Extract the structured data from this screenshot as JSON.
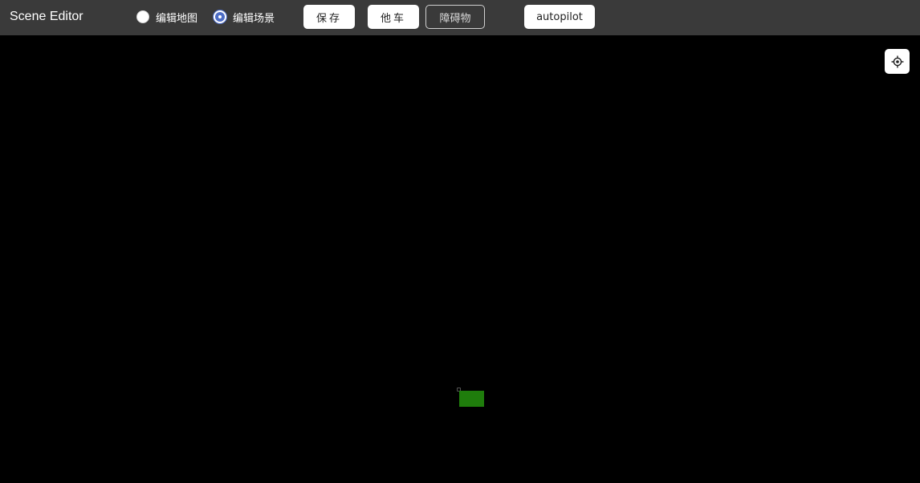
{
  "app": {
    "title": "Scene Editor"
  },
  "mode": {
    "options": [
      {
        "label": "编辑地图",
        "checked": false
      },
      {
        "label": "编辑场景",
        "checked": true
      }
    ]
  },
  "toolbar": {
    "save_label": "保存",
    "other_car_label": "他车",
    "obstacle_label": "障碍物",
    "autopilot_label": "autopilot"
  },
  "icons": {
    "locate": "crosshair-locate-icon"
  },
  "colors": {
    "toolbar_bg": "#3a3a3a",
    "canvas_bg": "#000000",
    "radio_accent": "#4c6cc6",
    "vehicle": "#1f7d0c"
  }
}
